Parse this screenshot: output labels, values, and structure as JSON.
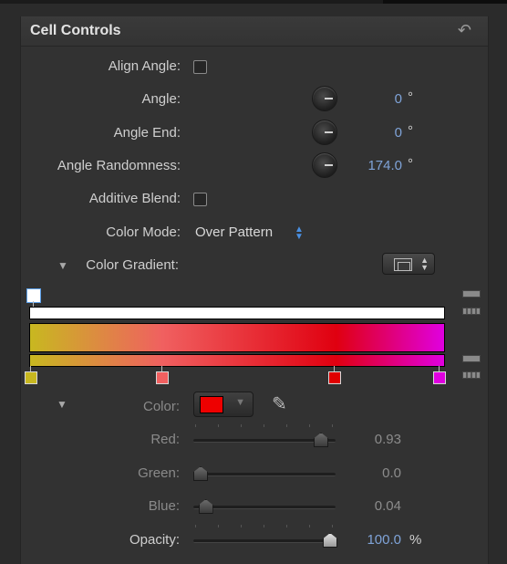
{
  "panel": {
    "title": "Cell Controls",
    "reset_icon": "↶"
  },
  "rows": {
    "align_angle": {
      "label": "Align Angle:",
      "checked": false
    },
    "angle": {
      "label": "Angle:",
      "value": "0",
      "unit": "°"
    },
    "angle_end": {
      "label": "Angle End:",
      "value": "0",
      "unit": "°"
    },
    "angle_randomness": {
      "label": "Angle Randomness:",
      "value": "174.0",
      "unit": "°"
    },
    "additive_blend": {
      "label": "Additive Blend:",
      "checked": false
    },
    "color_mode": {
      "label": "Color Mode:",
      "value": "Over Pattern",
      "arrows": "▲▼"
    },
    "color_gradient": {
      "label": "Color Gradient:",
      "disclosure": "▼"
    }
  },
  "gradient": {
    "opacity_stops": [
      "#ffffff"
    ],
    "color_stops": [
      "#c8b820",
      "#f06060",
      "#e00000",
      "#e000e0"
    ],
    "colors": {
      "start": "#c8b820",
      "mid1": "#f06060",
      "mid2": "#e00010",
      "end": "#e000e0"
    }
  },
  "color_editor": {
    "disclosure": "▼",
    "color_label": "Color:",
    "swatch_color": "#ee0000",
    "swatch_arrow": "▼",
    "eyedropper_icon": "✎",
    "red": {
      "label": "Red:",
      "value": "0.93",
      "fraction": 0.93
    },
    "green": {
      "label": "Green:",
      "value": "0.0",
      "fraction": 0.0
    },
    "blue": {
      "label": "Blue:",
      "value": "0.04",
      "fraction": 0.04
    },
    "opacity": {
      "label": "Opacity:",
      "value": "100.0",
      "unit": "%",
      "fraction": 1.0
    }
  }
}
